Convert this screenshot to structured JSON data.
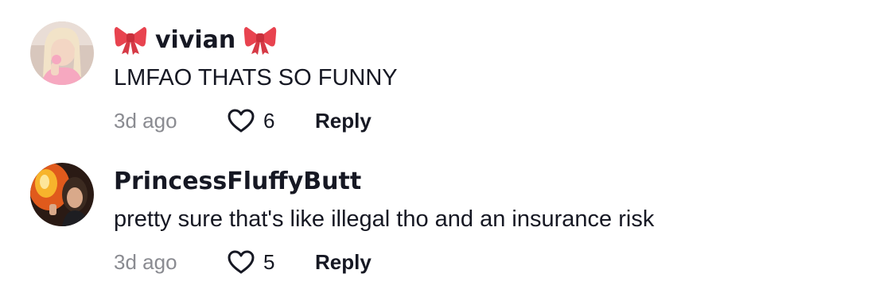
{
  "comments": [
    {
      "username": "vivian",
      "decoration_icon": "ribbon-bow-icon",
      "text": "LMFAO THATS SO FUNNY",
      "timestamp": "3d ago",
      "likes": "6",
      "reply_label": "Reply",
      "like_icon": "heart-outline-icon"
    },
    {
      "username": "PrincessFluffyButt",
      "text": "pretty sure that's like illegal tho and an insurance risk",
      "timestamp": "3d ago",
      "likes": "5",
      "reply_label": "Reply",
      "like_icon": "heart-outline-icon"
    }
  ],
  "colors": {
    "text_primary": "#161823",
    "text_secondary": "#8a8b91",
    "bow": "#e8434f"
  }
}
